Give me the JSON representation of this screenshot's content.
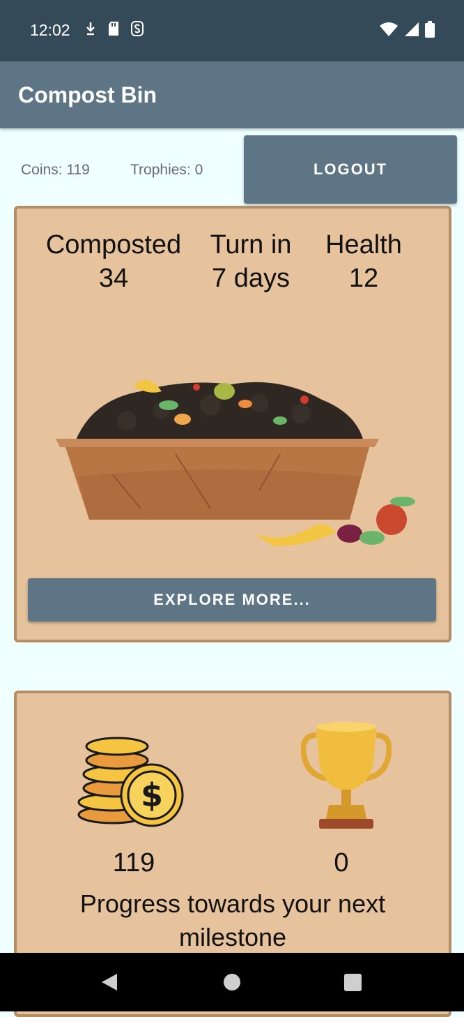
{
  "status_bar": {
    "time": "12:02",
    "left_icons": [
      "download-icon",
      "sd-card-icon",
      "s-icon"
    ],
    "right_icons": [
      "wifi-icon",
      "signal-icon",
      "battery-icon"
    ]
  },
  "app_bar": {
    "title": "Compost Bin"
  },
  "header": {
    "coins_label": "Coins: 119",
    "trophies_label": "Trophies: 0",
    "logout_label": "LOGOUT"
  },
  "compost_card": {
    "composted_label": "Composted",
    "composted_value": "34",
    "turn_label": "Turn in",
    "turn_value": "7 days",
    "health_label": "Health",
    "health_value": "12",
    "explore_label": "EXPLORE MORE...",
    "image_icon": "compost-bin-illustration"
  },
  "rewards_card": {
    "coins_value": "119",
    "trophies_value": "0",
    "progress_text": "Progress towards your next milestone",
    "coins_icon": "coins-icon",
    "trophy_icon": "trophy-icon"
  },
  "nav_bar": {
    "icons": [
      "back-icon",
      "home-icon",
      "recents-icon"
    ]
  },
  "colors": {
    "status_bar": "#344a59",
    "app_bar": "#5d7584",
    "background": "#f0ffff",
    "card_fill": "#e6c39c",
    "card_border": "#b28e66",
    "button": "#5d7584"
  }
}
